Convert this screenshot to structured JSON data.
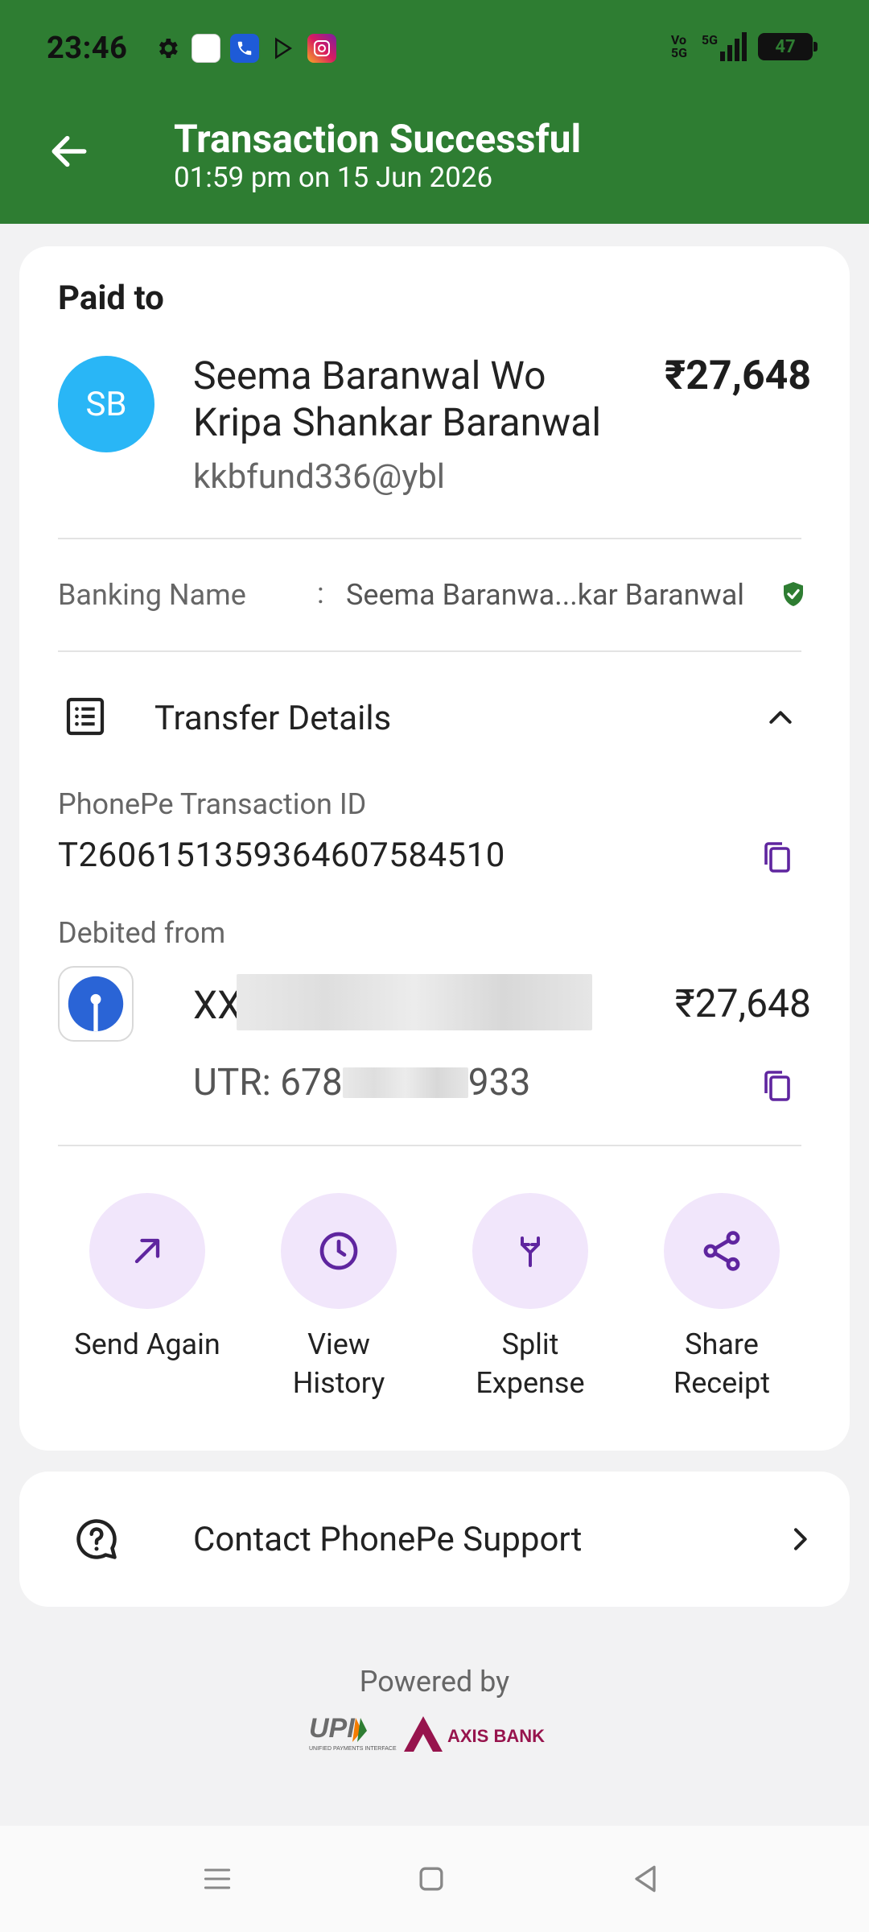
{
  "status_bar": {
    "time": "23:46",
    "network": "5G",
    "battery": "47"
  },
  "header": {
    "title": "Transaction Successful",
    "subtitle": "01:59 pm on 15 Jun 2026",
    "accent": "#2e7d32"
  },
  "payee": {
    "section_label": "Paid to",
    "initials": "SB",
    "name": "Seema Baranwal Wo Kripa Shankar Baranwal",
    "vpa": "kkbfund336@ybl",
    "amount": "₹27,648",
    "banking_name_label": "Banking Name",
    "banking_name_sep": ":",
    "banking_name_value": "Seema Baranwa...kar Baranwal"
  },
  "transfer": {
    "title": "Transfer Details",
    "txn_id_label": "PhonePe Transaction ID",
    "txn_id": "T2606151359364607584510",
    "debited_label": "Debited from",
    "account_prefix": "XX",
    "amount": "₹27,648",
    "utr_prefix": "UTR: 678",
    "utr_suffix": "933"
  },
  "actions": [
    {
      "label": "Send Again",
      "icon": "arrow-up-right-icon"
    },
    {
      "label": "View\nHistory",
      "icon": "clock-icon"
    },
    {
      "label": "Split\nExpense",
      "icon": "split-icon"
    },
    {
      "label": "Share\nReceipt",
      "icon": "share-icon"
    }
  ],
  "support": {
    "label": "Contact PhonePe Support"
  },
  "footer": {
    "powered_by": "Powered by",
    "upi_text": "UPI",
    "upi_subtext": "UNIFIED PAYMENTS INTERFACE",
    "bank_text": "AXIS BANK"
  }
}
